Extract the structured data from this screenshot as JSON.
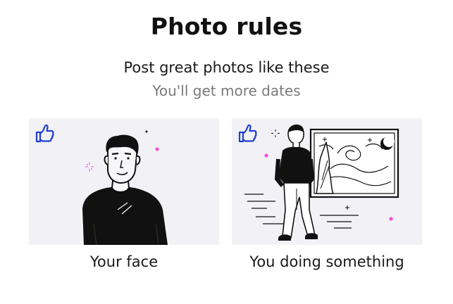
{
  "header": {
    "title": "Photo rules",
    "subtitle": "Post great photos like these",
    "note": "You'll get more dates"
  },
  "cards": [
    {
      "caption": "Your face",
      "badge_icon": "thumbs-up-icon",
      "illustration": "portrait-face"
    },
    {
      "caption": "You doing something",
      "badge_icon": "thumbs-up-icon",
      "illustration": "man-by-painting"
    }
  ],
  "colors": {
    "accent": "#1f3fd1",
    "card_bg": "#f2f2f6",
    "sparkle": "#ff4fd8",
    "subtle_text": "#7a7a7a"
  }
}
